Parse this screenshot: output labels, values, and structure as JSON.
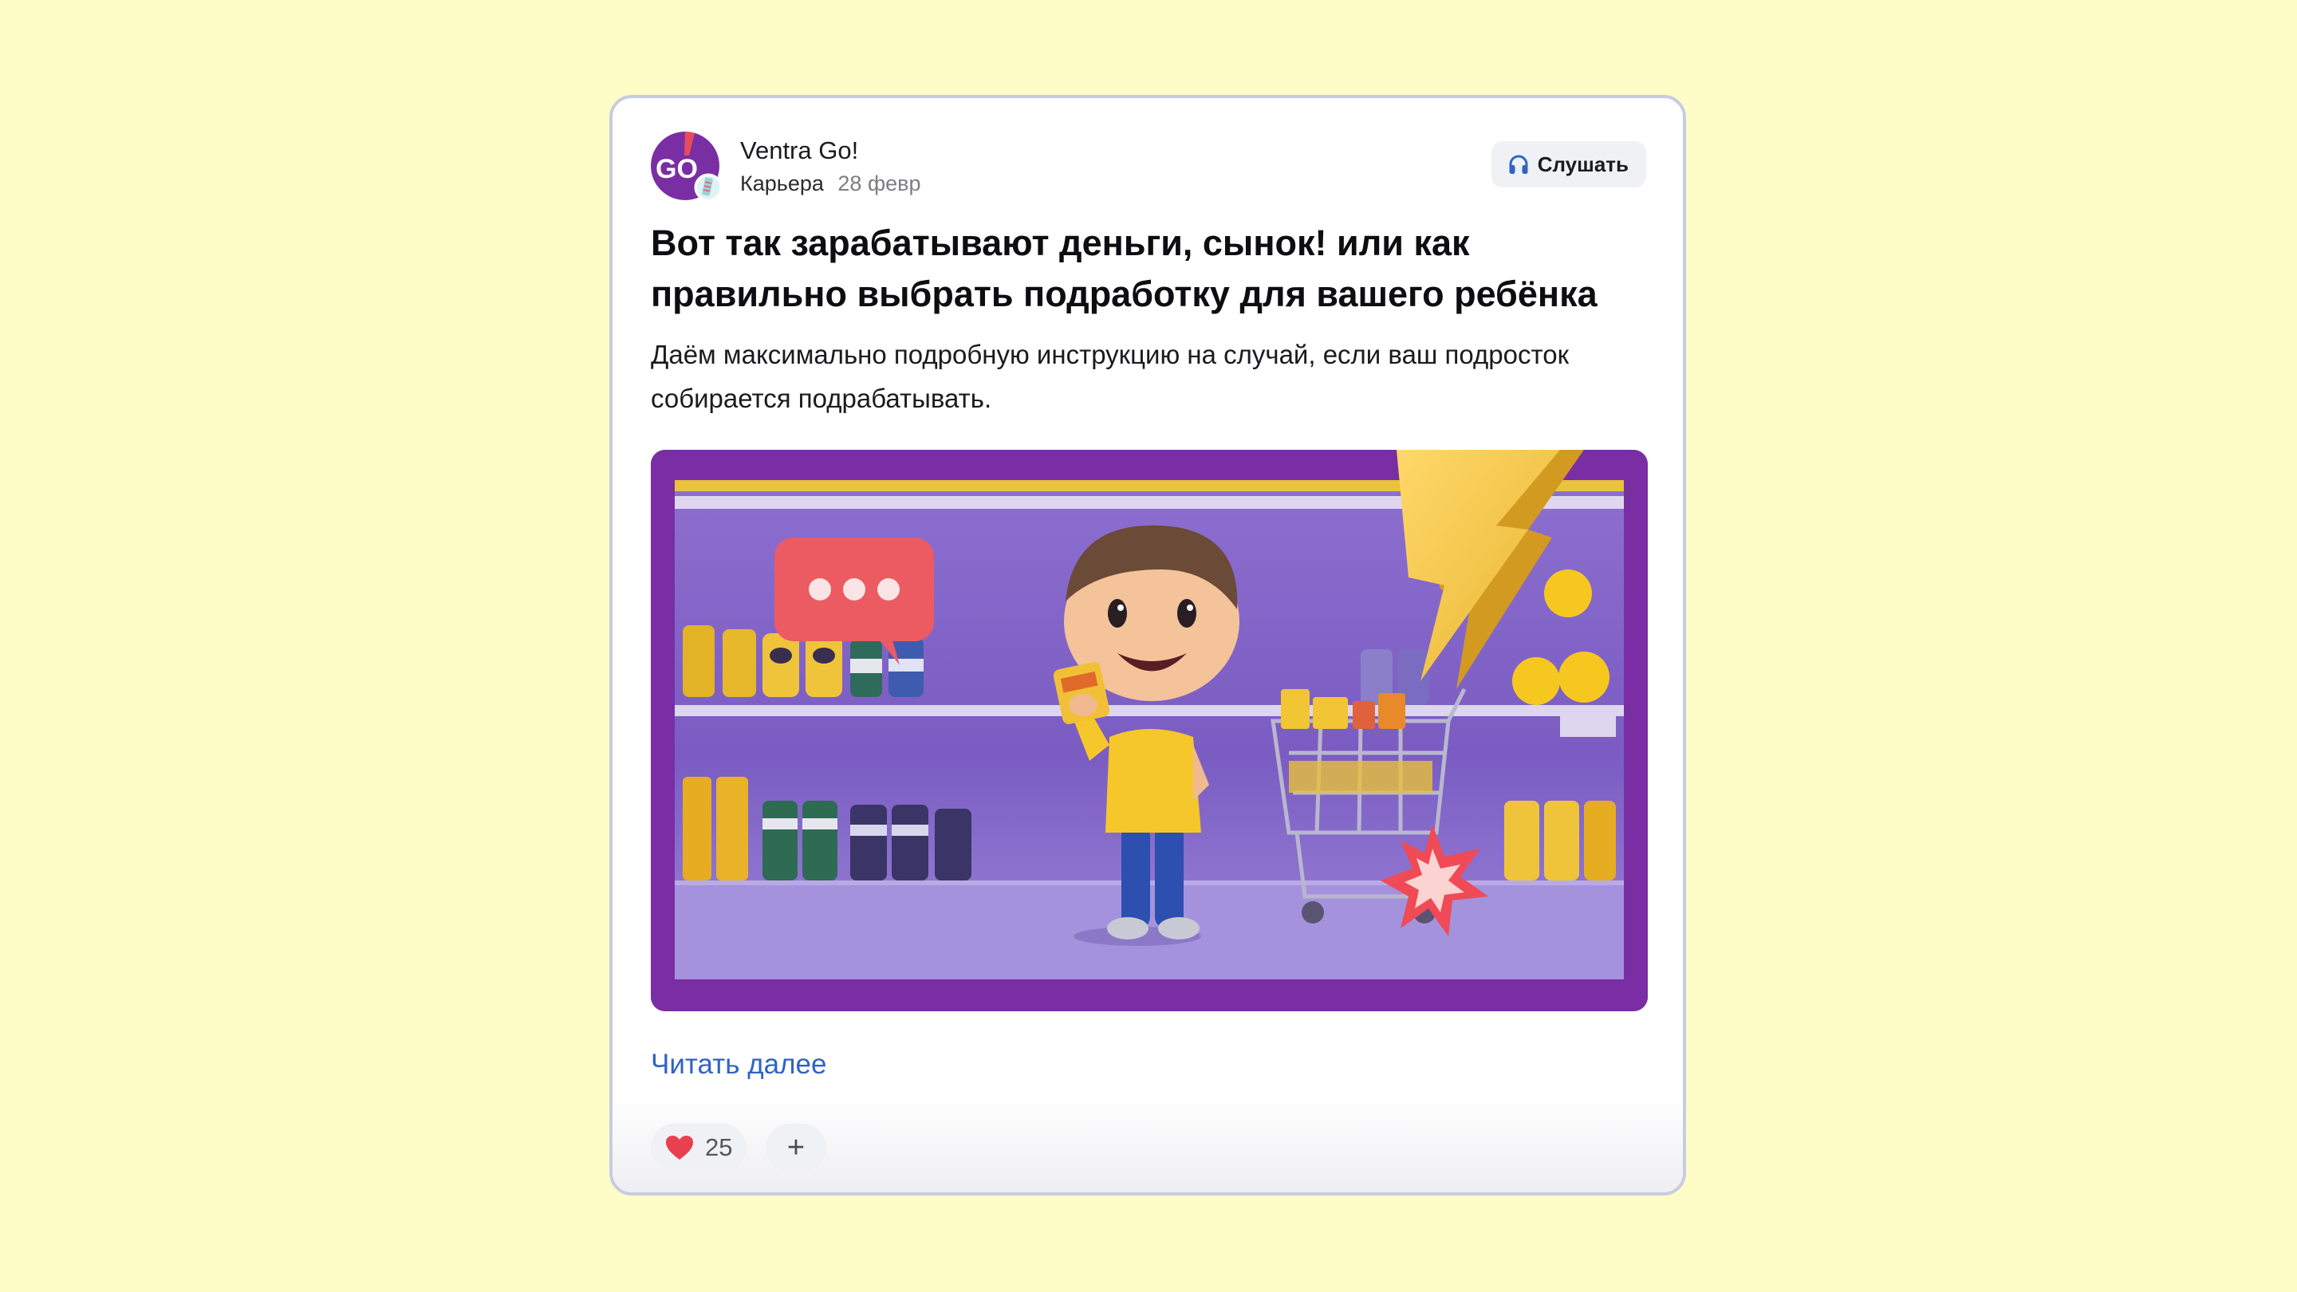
{
  "post": {
    "channel": {
      "name": "Ventra Go!",
      "avatar_icon": "ventra-go-logo",
      "avatar_text": "GO"
    },
    "category": "Карьера",
    "date": "28 февр",
    "listen_button": {
      "label": "Слушать",
      "icon": "headphones-icon"
    },
    "title": "Вот так зарабатывают деньги, сынок! или как правильно выбрать подработку для вашего ребёнка",
    "lead": "Даём максимально подробную инструкцию на случай, если ваш подросток собирается подрабатывать.",
    "cover_image": {
      "frame_color": "#7a2ea4"
    },
    "read_more_label": "Читать далее",
    "reactions": {
      "icon": "heart-icon",
      "count": "25",
      "add_label": "+"
    }
  },
  "colors": {
    "page_background": "#fefdc8",
    "card_border": "#c8cce0",
    "link": "#2f63c5",
    "heart": "#e8404e",
    "brand_purple": "#7a2ea4"
  }
}
